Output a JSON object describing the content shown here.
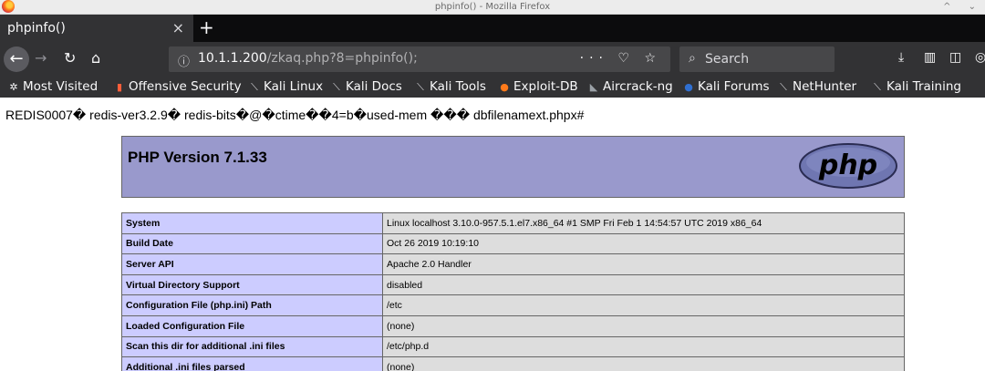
{
  "window": {
    "title": "phpinfo() - Mozilla Firefox",
    "controls": "^ ⌄"
  },
  "tabs": [
    {
      "label": "phpinfo()"
    }
  ],
  "navbar": {
    "url_host": "10.1.1.200",
    "url_path": "/zkaq.php?8=phpinfo();",
    "url_actions": "··· ♡ ☆",
    "search_placeholder": "Search"
  },
  "bookmarks": [
    {
      "label": "Most Visited",
      "icon": "gear-icon"
    },
    {
      "label": "Offensive Security",
      "icon": "offsec-icon"
    },
    {
      "label": "Kali Linux",
      "icon": "kali-dragon-icon"
    },
    {
      "label": "Kali Docs",
      "icon": "kali-dragon-icon"
    },
    {
      "label": "Kali Tools",
      "icon": "kali-dragon-icon"
    },
    {
      "label": "Exploit-DB",
      "icon": "exploitdb-icon"
    },
    {
      "label": "Aircrack-ng",
      "icon": "aircrack-icon"
    },
    {
      "label": "Kali Forums",
      "icon": "forums-icon"
    },
    {
      "label": "NetHunter",
      "icon": "kali-dragon-icon"
    },
    {
      "label": "Kali Training",
      "icon": "kali-dragon-icon"
    }
  ],
  "page": {
    "redis_dump": "REDIS0007� redis-ver3.2.9� redis-bits�@�ctime��4=b�used-mem ��� dbfilenamext.phpx#",
    "php_version": "PHP Version 7.1.33",
    "logo_text": "php",
    "rows": [
      {
        "key": "System",
        "value": "Linux localhost 3.10.0-957.5.1.el7.x86_64 #1 SMP Fri Feb 1 14:54:57 UTC 2019 x86_64"
      },
      {
        "key": "Build Date",
        "value": "Oct 26 2019 10:19:10"
      },
      {
        "key": "Server API",
        "value": "Apache 2.0 Handler"
      },
      {
        "key": "Virtual Directory Support",
        "value": "disabled"
      },
      {
        "key": "Configuration File (php.ini) Path",
        "value": "/etc"
      },
      {
        "key": "Loaded Configuration File",
        "value": "(none)"
      },
      {
        "key": "Scan this dir for additional .ini files",
        "value": "/etc/php.d"
      },
      {
        "key": "Additional .ini files parsed",
        "value": "(none)"
      }
    ]
  },
  "colors": {
    "header_bg": "#9999cc",
    "key_bg": "#ccccff",
    "value_bg": "#dddddd",
    "tab_bg": "#323234"
  }
}
